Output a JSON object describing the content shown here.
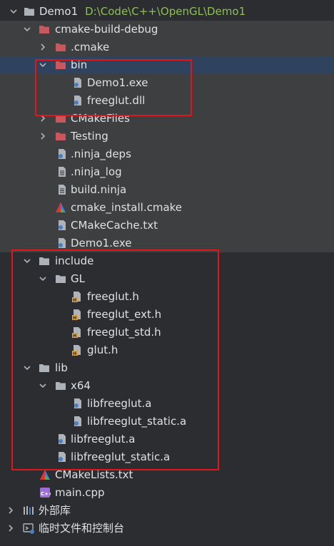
{
  "tree": {
    "root": {
      "label": "Demo1",
      "path": "D:\\Code\\C++\\OpenGL\\Demo1"
    },
    "items": [
      {
        "label": "cmake-build-debug"
      },
      {
        "label": ".cmake"
      },
      {
        "label": "bin"
      },
      {
        "label": "Demo1.exe"
      },
      {
        "label": "freeglut.dll"
      },
      {
        "label": "CMakeFiles"
      },
      {
        "label": "Testing"
      },
      {
        "label": ".ninja_deps"
      },
      {
        "label": ".ninja_log"
      },
      {
        "label": "build.ninja"
      },
      {
        "label": "cmake_install.cmake"
      },
      {
        "label": "CMakeCache.txt"
      },
      {
        "label": "Demo1.exe"
      },
      {
        "label": "include"
      },
      {
        "label": "GL"
      },
      {
        "label": "freeglut.h"
      },
      {
        "label": "freeglut_ext.h"
      },
      {
        "label": "freeglut_std.h"
      },
      {
        "label": "glut.h"
      },
      {
        "label": "lib"
      },
      {
        "label": "x64"
      },
      {
        "label": "libfreeglut.a"
      },
      {
        "label": "libfreeglut_static.a"
      },
      {
        "label": "libfreeglut.a"
      },
      {
        "label": "libfreeglut_static.a"
      },
      {
        "label": "CMakeLists.txt"
      },
      {
        "label": "main.cpp"
      },
      {
        "label": "外部库"
      },
      {
        "label": "临时文件和控制台"
      }
    ]
  },
  "colors": {
    "background": "#2b2d30",
    "excluded_background": "#3d3f41",
    "selection": "#2f435f",
    "path_text": "#8fbf55",
    "highlight_box": "#e0161b",
    "folder": "#aeb3ba",
    "excluded_folder": "#c9575e"
  }
}
